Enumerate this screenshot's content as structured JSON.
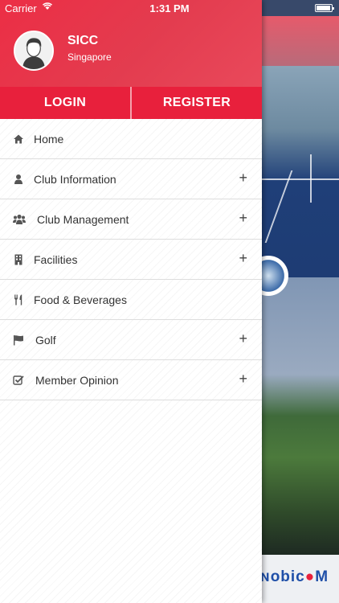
{
  "status_bar": {
    "carrier": "Carrier",
    "time": "1:31 PM",
    "battery_level": 0.95
  },
  "profile": {
    "name": "SICC",
    "location": "Singapore",
    "avatar_icon": "user-avatar-icon"
  },
  "auth": {
    "login_label": "LOGIN",
    "register_label": "REGISTER"
  },
  "menu": [
    {
      "label": "Home",
      "icon": "home-icon",
      "expandable": false
    },
    {
      "label": "Club Information",
      "icon": "user-icon",
      "expandable": true
    },
    {
      "label": "Club Management",
      "icon": "users-icon",
      "expandable": true
    },
    {
      "label": "Facilities",
      "icon": "building-icon",
      "expandable": true
    },
    {
      "label": "Food & Beverages",
      "icon": "cutlery-icon",
      "expandable": false
    },
    {
      "label": "Golf",
      "icon": "flag-icon",
      "expandable": true
    },
    {
      "label": "Member Opinion",
      "icon": "checkbox-icon",
      "expandable": true
    }
  ],
  "background_app": {
    "footer_brand": "mobicom"
  },
  "colors": {
    "accent": "#e8203c",
    "header": "#ec2e45"
  }
}
